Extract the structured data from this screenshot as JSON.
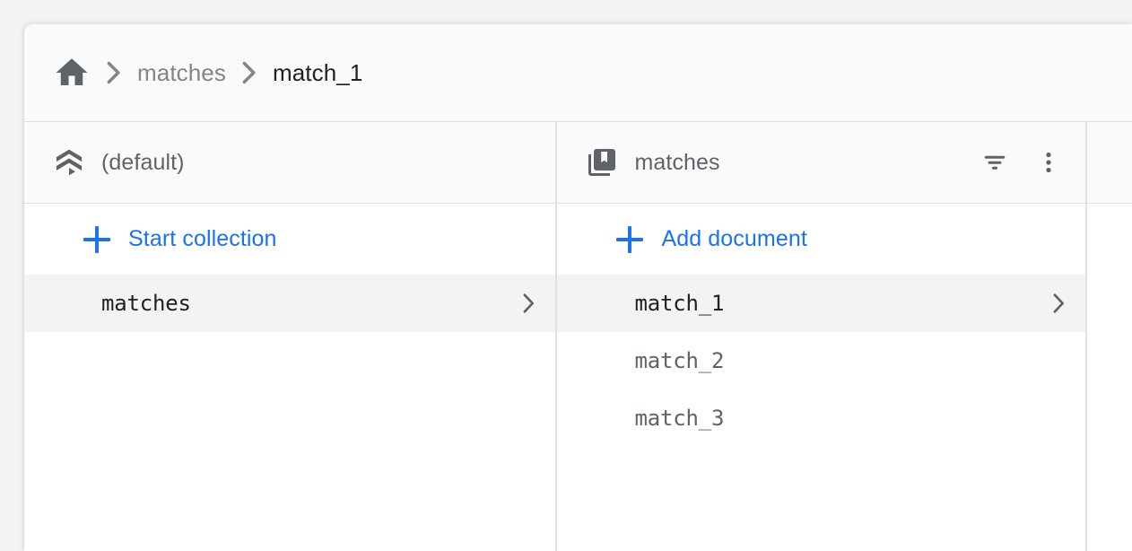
{
  "app": {
    "background_color": "#f1f3f4",
    "card_background": "#fafafa",
    "accent_color": "#1a73e8",
    "selected_row_color": "#f1f3f4",
    "primary_text_color": "#202124",
    "secondary_text_color": "#5f6368",
    "divider_color": "#e0e0e0"
  },
  "breadcrumb": {
    "home_icon": "home-icon",
    "separator": "chevron-right-icon",
    "items": [
      {
        "label": "matches",
        "current": false
      },
      {
        "label": "match_1",
        "current": true
      }
    ]
  },
  "panels": {
    "database": {
      "icon": "firestore-database-icon",
      "title": "(default)",
      "add_action": {
        "icon": "plus-icon",
        "label": "Start collection"
      },
      "rows": [
        {
          "label": "matches",
          "selected": true,
          "chevron": "chevron-right-icon"
        }
      ]
    },
    "collection": {
      "icon": "collections-bookmark-icon",
      "title": "matches",
      "actions": [
        {
          "name": "filter-icon",
          "tooltip": "Filter"
        },
        {
          "name": "more-vert-icon",
          "tooltip": "More"
        }
      ],
      "add_action": {
        "icon": "plus-icon",
        "label": "Add document"
      },
      "rows": [
        {
          "label": "match_1",
          "selected": true,
          "chevron": "chevron-right-icon"
        },
        {
          "label": "match_2",
          "selected": false,
          "chevron": ""
        },
        {
          "label": "match_3",
          "selected": false,
          "chevron": ""
        }
      ]
    },
    "document": {
      "title": "",
      "rows": []
    }
  }
}
